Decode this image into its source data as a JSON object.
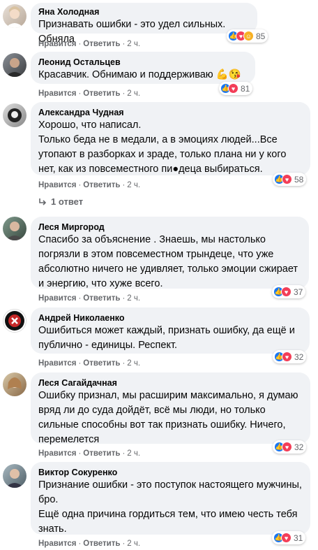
{
  "comments": [
    {
      "author": "Яна Холодная",
      "text": "Признавать ошибки - это удел сильных. Обняла",
      "count": "85",
      "like": "Нравится",
      "reply": "Ответить",
      "time": "2 ч."
    },
    {
      "author": "Леонид Остальцев",
      "text": "Красавчик. Обнимаю и поддерживаю 💪😘",
      "count": "81",
      "like": "Нравится",
      "reply": "Ответить",
      "time": "2 ч."
    },
    {
      "author": "Александра Чудная",
      "text": "Хорошо, что написал.\nТолько беда не в медали, а в эмоциях людей...Все утопают в разборках и зраде, только плана ни у кого нет, как из повсеместного пи●деца выбираться.",
      "count": "58",
      "like": "Нравится",
      "reply": "Ответить",
      "time": "2 ч."
    },
    {
      "author": "Леся Миргород",
      "text": "Спасибо за объяснение . Знаешь, мы настолько погрязли в этом повсеместном трындеце, что уже абсолютно ничего не удивляет, только эмоции сжирает и энергию, что хуже всего.",
      "count": "37",
      "like": "Нравится",
      "reply": "Ответить",
      "time": "2 ч."
    },
    {
      "author": "Андрей Николаенко",
      "text": "Ошибиться может каждый, признать ошибку, да ещё и публично - единицы. Респект.",
      "count": "32",
      "like": "Нравится",
      "reply": "Ответить",
      "time": "2 ч."
    },
    {
      "author": "Леся Сагайдачная",
      "text": "Ошибку признал, мы расширим максимально, я думаю вряд ли до суда дойдёт, всё мы люди, но только сильные способны вот так признать ошибку. Ничего, перемелется",
      "count": "32",
      "like": "Нравится",
      "reply": "Ответить",
      "time": "2 ч."
    },
    {
      "author": "Виктор Сокуренко",
      "text": "Признание ошибки - это поступок настоящего мужчины, бро.\nЕщё одна причина гордиться тем, что имею честь тебя знать.",
      "count": "31",
      "like": "Нравится",
      "reply": "Ответить",
      "time": "2 ч."
    }
  ],
  "replies_label": "1 ответ",
  "colors": {
    "bubble": "#f0f2f5",
    "like": "#1877f2",
    "love": "#f33e58",
    "haha": "#f7b125",
    "meta": "#65676b"
  }
}
